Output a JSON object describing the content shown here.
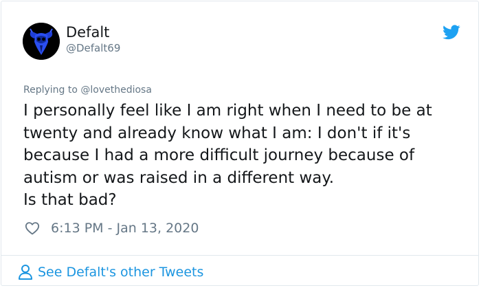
{
  "author": {
    "display_name": "Defalt",
    "handle": "@Defalt69"
  },
  "reply": {
    "prefix": "Replying to",
    "mention": "@lovethediosa"
  },
  "tweet": {
    "text_1": "I personally feel like I am right when I need to be at twenty and already know what I am: I don't if it's because I had a more difficult journey because of autism or was raised in a different way.",
    "text_2": "Is that bad?",
    "timestamp": "6:13 PM - Jan 13, 2020"
  },
  "footer": {
    "more_link": "See Defalt's other Tweets"
  },
  "icons": {
    "brand": "twitter-bird-icon",
    "like": "heart-icon",
    "profile": "person-icon",
    "avatar": "horned-skull-icon"
  },
  "colors": {
    "twitter_blue": "#1da1f2",
    "link_blue": "#1b95e0",
    "secondary_text": "#657786",
    "primary_text": "#14171a",
    "border": "#e1e8ed"
  }
}
